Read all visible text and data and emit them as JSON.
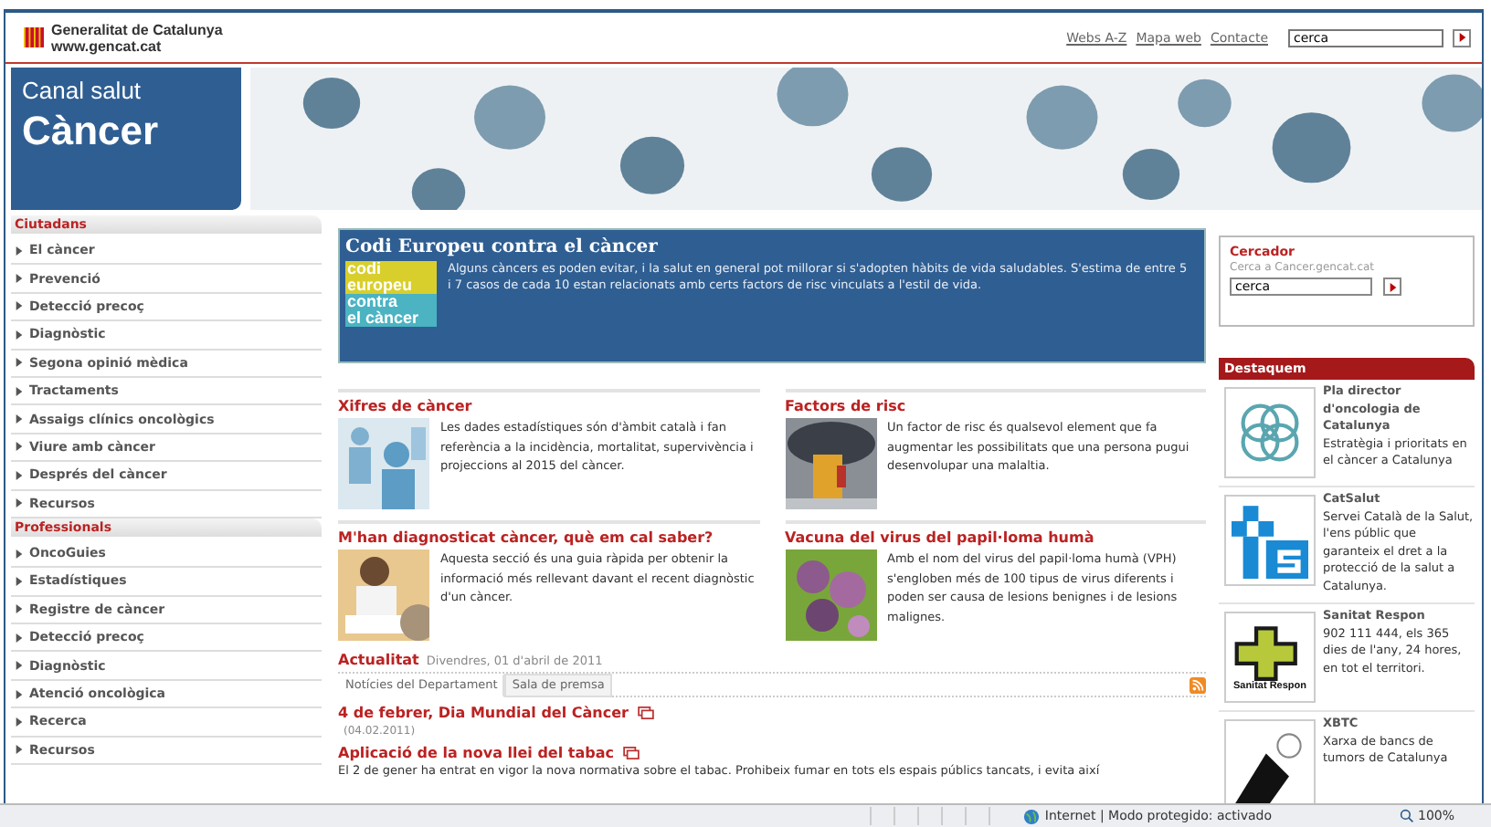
{
  "header": {
    "org_name": "Generalitat de Catalunya",
    "org_url": "www.gencat.cat",
    "links": [
      "Webs A-Z",
      "Mapa web",
      "Contacte"
    ],
    "search": {
      "value": "cerca"
    }
  },
  "banner": {
    "subtitle": "Canal salut",
    "title": "Càncer"
  },
  "sidebar": {
    "sections": [
      {
        "heading": "Ciutadans",
        "items": [
          "El càncer",
          "Prevenció",
          "Detecció precoç",
          "Diagnòstic",
          "Segona opinió mèdica",
          "Tractaments",
          "Assaigs clínics oncològics",
          "Viure amb càncer",
          "Després del càncer",
          "Recursos"
        ]
      },
      {
        "heading": "Professionals",
        "items": [
          "OncoGuies",
          "Estadístiques",
          "Registre de càncer",
          "Detecció precoç",
          "Diagnòstic",
          "Atenció oncològica",
          "Recerca",
          "Recursos"
        ]
      }
    ]
  },
  "feature": {
    "title": "Codi Europeu contra el càncer",
    "logo_lines": [
      "codi",
      "europeu",
      "contra",
      "el càncer"
    ],
    "text": "Alguns càncers es poden evitar, i la salut en general pot millorar si s'adopten hàbits de vida saludables. S'estima de entre 5 i 7 casos de cada 10 estan relacionats amb certs factors de risc vinculats a l'estil de vida."
  },
  "articles": [
    {
      "title": "Xifres de càncer",
      "text": "Les dades estadístiques són d'àmbit català i fan referència a la incidència, mortalitat, supervivència i projeccions al 2015 del càncer."
    },
    {
      "title": "Factors de risc",
      "text": "Un factor de risc és qualsevol element que fa augmentar les possibilitats que una persona pugui desenvolupar una malaltia."
    },
    {
      "title": "M'han diagnosticat càncer, què em cal saber?",
      "text": "Aquesta secció és una guia ràpida per obtenir la informació més rellevant davant el recent diagnòstic d'un càncer."
    },
    {
      "title": "Vacuna del virus del papil·loma humà",
      "text": "Amb el nom del virus del papil·loma humà (VPH) s'engloben més de 100 tipus de virus diferents i poden ser causa de lesions benignes i de lesions malignes."
    }
  ],
  "news": {
    "heading": "Actualitat",
    "date": "Divendres, 01 d'abril de 2011",
    "tabs": [
      {
        "label": "Notícies del Departament",
        "selected": true
      },
      {
        "label": "Sala de premsa",
        "selected": false
      }
    ],
    "items": [
      {
        "title": "4 de febrer, Dia Mundial del Càncer",
        "date": "(04.02.2011)"
      },
      {
        "title": "Aplicació de la nova llei del tabac",
        "text": "El 2 de gener ha entrat en vigor la nova normativa sobre el tabac. Prohibeix fumar en tots els espais públics tancats, i evita així"
      }
    ]
  },
  "search_box": {
    "title": "Cercador",
    "hint": "Cerca a Cancer.gencat.cat",
    "value": "cerca"
  },
  "highlights": {
    "heading": "Destaquem",
    "items": [
      {
        "kind": "rings",
        "title": "Pla director d'oncologia de Catalunya",
        "text": "Estratègia i prioritats en el càncer a Catalunya"
      },
      {
        "kind": "blocks",
        "title": "CatSalut",
        "text": "Servei Català de la Salut, l'ens públic que garanteix el dret a la protecció de la salut a Catalunya."
      },
      {
        "kind": "cross",
        "logo_text": "Sanitat Respon",
        "title": "Sanitat Respon",
        "text": "902 111 444, els 365 dies de l'any, 24 hores, en tot el territori."
      },
      {
        "kind": "sketch",
        "title": "XBTC",
        "text": "Xarxa de bancs de tumors de Catalunya"
      }
    ]
  },
  "status_bar": {
    "zone": "Internet | Modo protegido: activado",
    "zoom": "100%"
  }
}
